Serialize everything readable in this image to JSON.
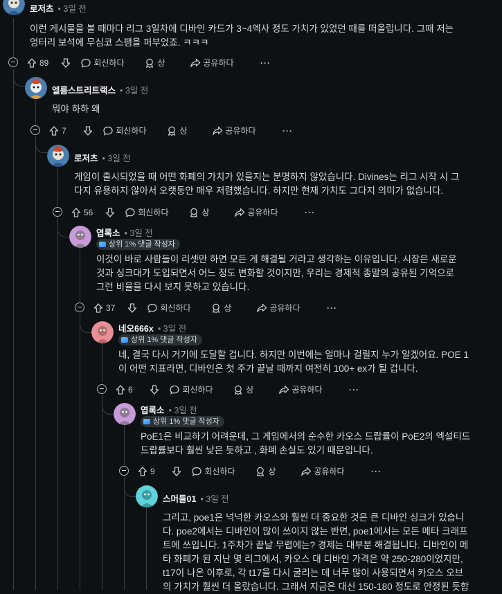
{
  "comments": [
    {
      "id": "c1",
      "author": "로저츠",
      "time": "• 3일 전",
      "lines": [
        "이런 게시물을 볼 때마다 리그 3일차에 디바인 카드가 3~4엑사 정도 가치가 있었던 때를 떠올립니다. 그때 저는",
        "엉터리 보석에 무심코 스팸을 퍼부었죠. ㅋㅋㅋ"
      ],
      "votes": "89"
    },
    {
      "id": "c2",
      "author": "엘름스트리트랙스",
      "time": "• 3일 전",
      "lines": [
        "뭐야 하하 왜"
      ],
      "votes": "7"
    },
    {
      "id": "c3",
      "author": "로저츠",
      "time": "• 3일 전",
      "lines": [
        "게임이 출시되었을 때 어떤 화폐의 가치가 있을지는 분명하지 않았습니다. Divines는 리그 시작 시 그",
        "다지 유용하지 않아서 오랫동안 매우 저렴했습니다. 하지만 현재 가치도 그다지 의미가 없습니다."
      ],
      "votes": "56"
    },
    {
      "id": "c4",
      "author": "엽록소",
      "time": "• 3일 전",
      "badge": "상위 1% 댓글 작성자",
      "lines": [
        "이것이 바로 사람들이 리셋만 하면 모든 게 해결될 거라고 생각하는 이유입니다. 시장은 새로운",
        "것과 싱크대가 도입되면서 어느 정도 변화할 것이지만, 우리는 경제적 종말의 공유된 기억으로",
        "그런 비율을 다시 보지 못하고 있습니다."
      ],
      "votes": "37"
    },
    {
      "id": "c5",
      "author": "네오666x",
      "time": "• 3일 전",
      "badge": "상위 1% 댓글 작성자",
      "lines": [
        "네, 결국 다시 거기에 도달할 겁니다. 하지만 이번에는 얼마나 걸릴지 누가 알겠어요. POE 1",
        "이 어떤 지표라면, 디바인은 첫 주가 끝날 때까지 여전히 100+ ex가 될 겁니다."
      ],
      "votes": "6"
    },
    {
      "id": "c6",
      "author": "엽록소",
      "time": "• 3일 전",
      "badge": "상위 1% 댓글 작성자",
      "lines": [
        "PoE1은 비교하기 어려운데, 그 게임에서의 순수한 카오스 드랍률이 PoE2의 엑설티드",
        "드랍률보다 훨씬 낮은 듯하고 , 화폐 손실도 있기 때문입니다."
      ],
      "votes": "9"
    },
    {
      "id": "c7",
      "author": "스머들01",
      "time": "• 3일 전",
      "lines": [
        "그리고, poe1은 넉넉한 카오스와 훨씬 더 중요한 것은 큰 디바인 싱크가 있습니",
        "다. poe2에서는 디바인이 많이 쓰이지 않는 반면, poe1에서는 모든 메타 크래프",
        "트에 쓰입니다. 1주차가 끝날 무렵에는? 경제는 대부분 해결됩니다. 디바인이 메",
        "타 화폐가 된 지난 몇 리그에서, 카오스 대 디바인 가격은 약 250-280이었지만,",
        "t17이 나온 이후로, 각 t17을 다시 굴리는 데 너무 많이 사용되면서 카오스 오브",
        "의 가치가 훨씬 더 올랐습니다. 그래서 지금은 대신 150-180 정도로 안정된 듯합"
      ]
    }
  ],
  "actions": {
    "reply": "회신하다",
    "award": "상",
    "share": "공유하다",
    "more": "···"
  },
  "icons": [
    "upvote-icon",
    "downvote-icon",
    "reply-icon",
    "award-icon",
    "share-icon",
    "more-icon",
    "collapse-icon",
    "avatar-icon"
  ],
  "colors": {
    "background": "#0e1113",
    "text": "#d7dadc",
    "muted": "#8a8f94",
    "thread": "#3a3f43"
  }
}
